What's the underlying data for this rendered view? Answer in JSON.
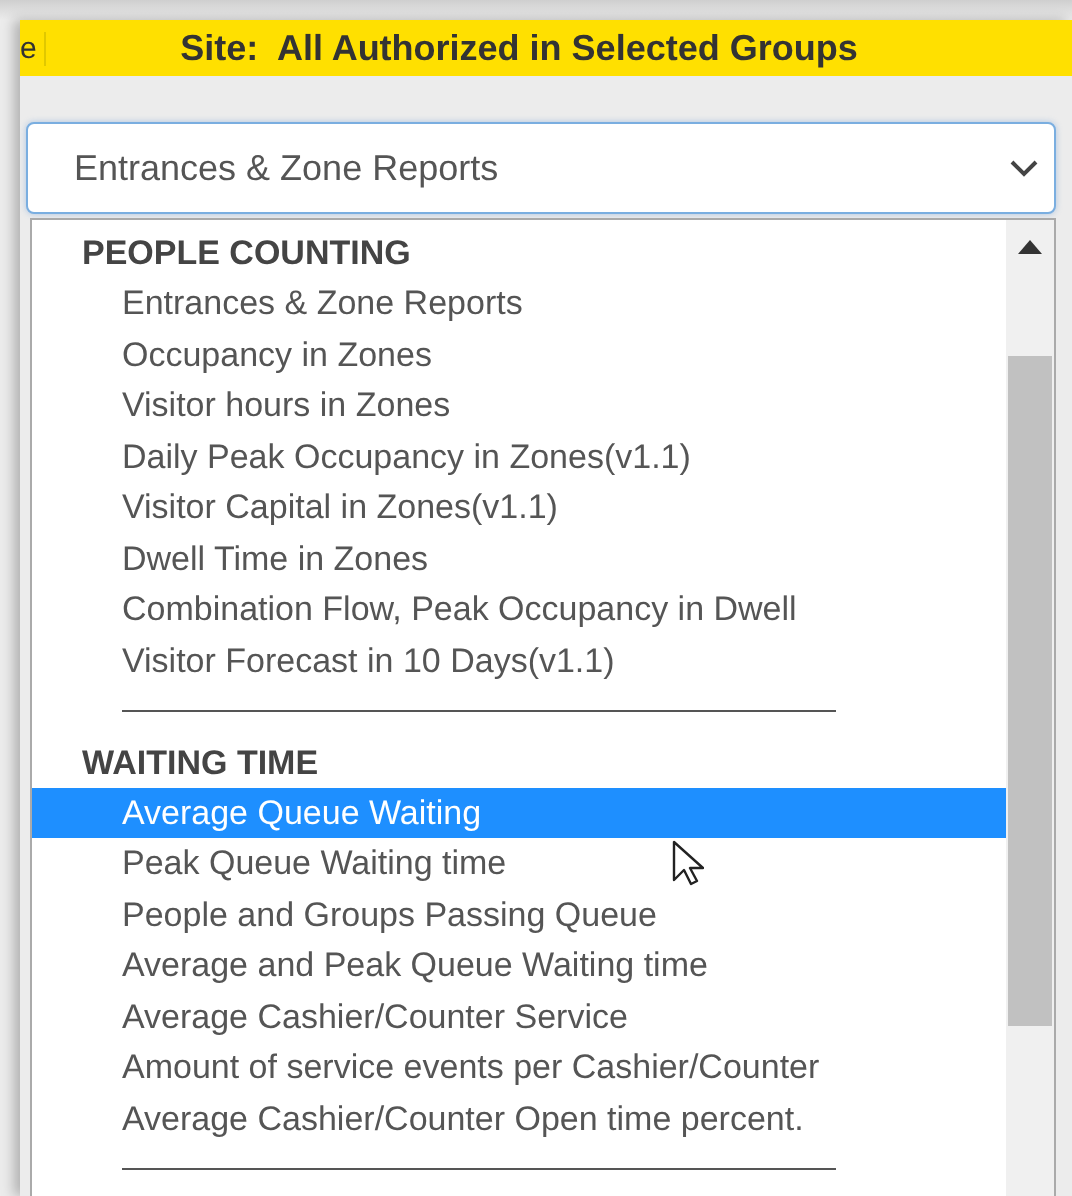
{
  "banner": {
    "edge_text": "e",
    "title": "Site:  All Authorized in Selected Groups"
  },
  "report_select": {
    "value": "Entrances & Zone Reports"
  },
  "groups": [
    {
      "header": "PEOPLE COUNTING",
      "items": [
        {
          "label": "Entrances & Zone Reports",
          "selected": false
        },
        {
          "label": "Occupancy in Zones",
          "selected": false
        },
        {
          "label": "Visitor hours in Zones",
          "selected": false
        },
        {
          "label": "Daily Peak Occupancy in Zones(v1.1)",
          "selected": false
        },
        {
          "label": "Visitor Capital in Zones(v1.1)",
          "selected": false
        },
        {
          "label": "Dwell Time in Zones",
          "selected": false
        },
        {
          "label": "Combination Flow, Peak Occupancy in Dwell",
          "selected": false
        },
        {
          "label": "Visitor Forecast in 10 Days(v1.1)",
          "selected": false
        }
      ]
    },
    {
      "header": "WAITING TIME",
      "items": [
        {
          "label": "Average Queue Waiting",
          "selected": true
        },
        {
          "label": "Peak Queue Waiting time",
          "selected": false
        },
        {
          "label": "People and Groups Passing Queue",
          "selected": false
        },
        {
          "label": "Average and Peak Queue Waiting time",
          "selected": false
        },
        {
          "label": "Average Cashier/Counter Service",
          "selected": false
        },
        {
          "label": "Amount of service events per Cashier/Counter",
          "selected": false
        },
        {
          "label": "Average Cashier/Counter Open time percent.",
          "selected": false
        }
      ]
    }
  ]
}
